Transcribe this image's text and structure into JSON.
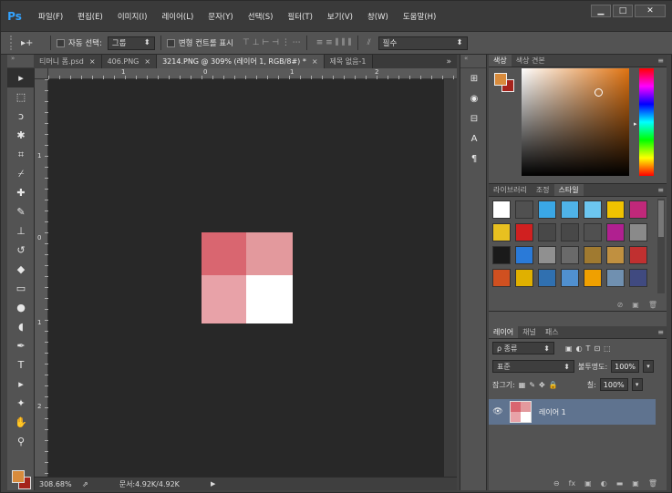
{
  "app": {
    "logo": "Ps"
  },
  "menu": [
    "파일(F)",
    "편집(E)",
    "이미지(I)",
    "레이어(L)",
    "문자(Y)",
    "선택(S)",
    "필터(T)",
    "보기(V)",
    "창(W)",
    "도움말(H)"
  ],
  "window_controls": {
    "minimize": "▁",
    "maximize": "□",
    "close": "✕"
  },
  "options": {
    "move_icon": "▸+",
    "auto_select_label": "자동 선택:",
    "auto_select_value": "그룹",
    "transform_label": "변형 컨트롤 표시",
    "align_glyphs": "⊤ ⊥ ⊢ ⊣ ⋮ ⋯",
    "distribute_glyphs": "≡ ≡ ⫼ ⫼ ⫼",
    "spacing_glyph": "⫽",
    "workspace_value": "필수"
  },
  "tabs": [
    {
      "label": "티머니 폼.psd",
      "active": false
    },
    {
      "label": "406.PNG",
      "active": false
    },
    {
      "label": "3214.PNG @ 309% (레이어 1, RGB/8#) *",
      "active": true
    },
    {
      "label": "제목 없음-1",
      "active": false
    }
  ],
  "tab_overflow": "»",
  "tab_close": "×",
  "ruler": {
    "h_labels": [
      "1",
      "0",
      "1",
      "2"
    ],
    "v_labels": [
      "1",
      "0",
      "1",
      "2"
    ]
  },
  "status": {
    "zoom": "308.68%",
    "doc_info": "문서:4.92K/4.92K",
    "arrow": "▶"
  },
  "tools": [
    "move-tool",
    "marquee-tool",
    "lasso-tool",
    "magic-wand-tool",
    "crop-tool",
    "eyedropper-tool",
    "healing-tool",
    "brush-tool",
    "stamp-tool",
    "history-brush-tool",
    "eraser-tool",
    "gradient-tool",
    "blur-tool",
    "dodge-tool",
    "pen-tool",
    "type-tool",
    "path-selection-tool",
    "shape-tool",
    "hand-tool",
    "zoom-tool"
  ],
  "tool_glyphs": [
    "▸",
    "⬚",
    "ↄ",
    "✱",
    "⌗",
    "⌿",
    "✚",
    "✎",
    "⊥",
    "↺",
    "◆",
    "▭",
    "●",
    "◖",
    "✒",
    "T",
    "▸",
    "✦",
    "✋",
    "⚲"
  ],
  "swatches": {
    "foreground": "#d88b3c",
    "background": "#a5231c"
  },
  "icon_strip": [
    "⊞",
    "◉",
    "⊟",
    "A",
    "¶"
  ],
  "color_panel": {
    "tabs": [
      "색상",
      "색상 견본"
    ]
  },
  "styles_panel": {
    "tabs": [
      "라이브러리",
      "조정",
      "스타일"
    ],
    "swatch_colors": [
      "#ffffff",
      "#505050",
      "#3aa7e6",
      "#4fb3e8",
      "#6cc6f0",
      "#f0c200",
      "#c0287a",
      "#e8c020",
      "#d02020",
      "#484848",
      "#484848",
      "#505050",
      "#b02090",
      "#8a8a8a",
      "#1a1a1a",
      "#2a7ad8",
      "#909090",
      "#6a6a6a",
      "#a07a30",
      "#c09040",
      "#c03030",
      "#d05020",
      "#e0b000",
      "#3070b0",
      "#5090d0",
      "#f0a000",
      "#7090b0",
      "#404a80"
    ],
    "footer_icons": [
      "⊘",
      "▣",
      "🗑"
    ]
  },
  "layers_panel": {
    "tabs": [
      "레이어",
      "채널",
      "패스"
    ],
    "filter_label": "ρ 종류",
    "filter_icons": [
      "▣",
      "◐",
      "T",
      "⊡",
      "⬚"
    ],
    "blend_mode": "표준",
    "opacity_label": "불투명도:",
    "opacity_value": "100%",
    "lock_label": "잠그기:",
    "lock_icons": [
      "▦",
      "✎",
      "✥",
      "🔒"
    ],
    "fill_label": "칠:",
    "fill_value": "100%",
    "layer_name": "레이어 1",
    "eye": "👁",
    "footer_icons": [
      "⊖",
      "fx",
      "▣",
      "◐",
      "▬",
      "▣",
      "🗑"
    ]
  },
  "image": {
    "quadrant_colors": [
      "#d96670",
      "#e3999d",
      "#e8a2a8",
      "#ffffff"
    ]
  }
}
